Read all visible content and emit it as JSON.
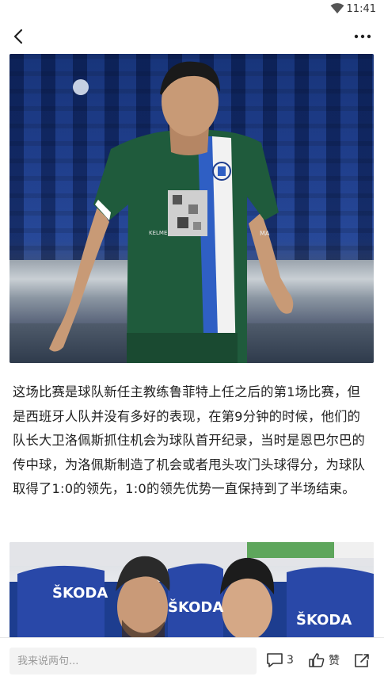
{
  "status_bar": {
    "time": "11:41"
  },
  "article": {
    "paragraph": "这场比赛是球队新任主教练鲁菲特上任之后的第1场比赛，但是西班牙人队并没有多好的表现，在第9分钟的时候，他们的队长大卫洛佩斯抓住机会为球队首开纪录，当时是恩巴尔巴的传中球，为洛佩斯制造了机会或者甩头攻门头球得分，为球队取得了1:0的领先，1:0的领先优势一直保持到了半场结束。"
  },
  "image1": {
    "shirt_text_kelme": "KELME",
    "shirt_text_ma": "MA"
  },
  "image2": {
    "board_1": "ŠKODA",
    "board_2": "ŠKODA",
    "board_3": "ŠKODA"
  },
  "bottom_bar": {
    "comment_placeholder": "我来说两句...",
    "comment_count": "3",
    "like_label": "赞"
  },
  "colors": {
    "accent_text": "#222222",
    "jersey_green": "#1f5b3c",
    "stadium_blue": "#1d3d8f"
  }
}
